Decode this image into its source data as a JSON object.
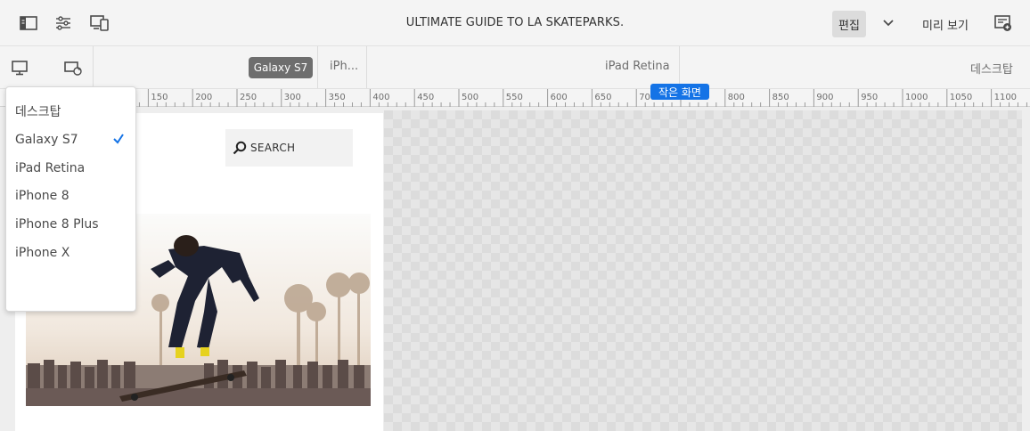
{
  "header": {
    "page_title": "ULTIMATE GUIDE TO LA SKATEPARKS.",
    "edit_label": "편집",
    "preview_label": "미리 보기",
    "icons": [
      "side-panel-icon",
      "properties-icon",
      "emulator-icon",
      "page-info-icon"
    ]
  },
  "emulator": {
    "selected_device": "Galaxy S7",
    "breakpoints": [
      "iPh...",
      "iPad Retina",
      "데스크탑"
    ],
    "ruler_ticks": [
      "150",
      "200",
      "250",
      "300",
      "350",
      "400",
      "450",
      "500",
      "550",
      "600",
      "650",
      "700",
      "800",
      "850",
      "900",
      "950",
      "1000",
      "1050",
      "1100"
    ],
    "ruler_badge": "작은 화면"
  },
  "device_menu": {
    "items": [
      {
        "label": "데스크탑",
        "checked": false
      },
      {
        "label": "Galaxy S7",
        "checked": true
      },
      {
        "label": "iPad Retina",
        "checked": false
      },
      {
        "label": "iPhone 8",
        "checked": false
      },
      {
        "label": "iPhone 8 Plus",
        "checked": false
      },
      {
        "label": "iPhone X",
        "checked": false
      }
    ]
  },
  "page": {
    "search_label": "SEARCH"
  },
  "colors": {
    "accent": "#1473e6",
    "toolbar_bg": "#f4f4f4",
    "chip_bg": "#6e6e6e"
  }
}
